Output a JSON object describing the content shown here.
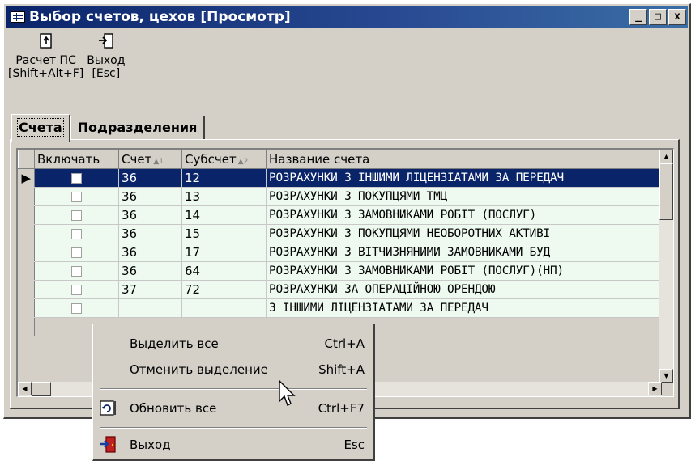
{
  "window": {
    "title": "Выбор счетов, цехов [Просмотр]",
    "controls": {
      "minimize": "_",
      "maximize": "□",
      "close": "x"
    }
  },
  "toolbar": {
    "calc": {
      "line1": "Расчет ПС",
      "line2": "[Shift+Alt+F]",
      "icon": "calculate-icon"
    },
    "exit": {
      "line1": "Выход",
      "line2": "[Esc]",
      "icon": "exit-door-icon"
    }
  },
  "tabs": [
    "Счета",
    "Подразделения"
  ],
  "grid": {
    "columns": [
      {
        "label": "Включать",
        "sort": ""
      },
      {
        "label": "Счет",
        "sort": "▲1"
      },
      {
        "label": "Субсчет",
        "sort": "▲2"
      },
      {
        "label": "Название счета",
        "sort": ""
      }
    ],
    "rows": [
      {
        "schet": "36",
        "subschet": "12",
        "name": "РОЗРАХУНКИ З ІНШИМИ ЛІЦЕНЗІАТАМИ ЗА ПЕРЕДАЧ"
      },
      {
        "schet": "36",
        "subschet": "13",
        "name": "РОЗРАХУНКИ З ПОКУПЦЯМИ ТМЦ"
      },
      {
        "schet": "36",
        "subschet": "14",
        "name": "РОЗРАХУНКИ З ЗАМОВНИКАМИ РОБІТ (ПОСЛУГ)"
      },
      {
        "schet": "36",
        "subschet": "15",
        "name": "РОЗРАХУНКИ З ПОКУПЦЯМИ НЕОБОРОТНИХ АКТИВІ"
      },
      {
        "schet": "36",
        "subschet": "17",
        "name": "РОЗРАХУНКИ З ВІТЧИЗНЯНИМИ ЗАМОВНИКАМИ БУД"
      },
      {
        "schet": "36",
        "subschet": "64",
        "name": "РОЗРАХУНКИ З ЗАМОВНИКАМИ РОБІТ (ПОСЛУГ)(НП)"
      },
      {
        "schet": "37",
        "subschet": "72",
        "name": "РОЗРАХУНКИ ЗА ОПЕРАЦІЙНОЮ ОРЕНДОЮ"
      },
      {
        "schet": "",
        "subschet": "",
        "name": "З ІНШИМИ ЛІЦЕНЗІАТАМИ ЗА ПЕРЕДАЧ"
      }
    ]
  },
  "context_menu": {
    "items": [
      {
        "label": "Выделить все",
        "shortcut": "Ctrl+A"
      },
      {
        "label": "Отменить выделение",
        "shortcut": "Shift+A"
      },
      {
        "label": "Обновить все",
        "shortcut": "Ctrl+F7",
        "icon": "refresh-icon"
      },
      {
        "label": "Выход",
        "shortcut": "Esc",
        "icon": "exit-door-icon"
      }
    ]
  },
  "colors": {
    "title_bar": "#0a246a",
    "selection": "#0a246a",
    "grid_row": "#eefaf0",
    "face": "#d4d0c8"
  }
}
